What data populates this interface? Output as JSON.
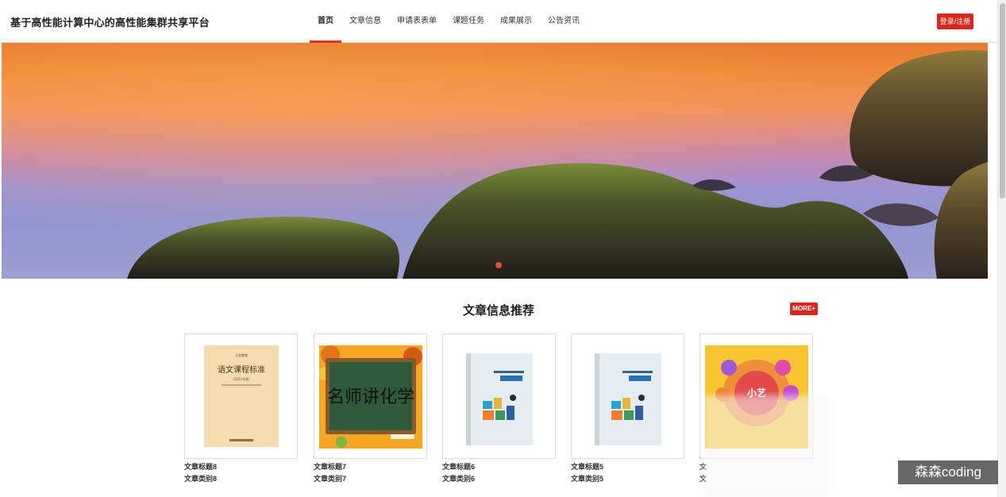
{
  "header": {
    "site_title": "基于高性能计算中心的高性能集群共享平台",
    "nav": [
      {
        "label": "首页",
        "active": true
      },
      {
        "label": "文章信息"
      },
      {
        "label": "申请表表单"
      },
      {
        "label": "课题任务"
      },
      {
        "label": "成果展示"
      },
      {
        "label": "公告资讯"
      }
    ],
    "login_label": "登录/注册"
  },
  "banner": {
    "slide_count": 1,
    "active_slide": 1
  },
  "section": {
    "title": "文章信息推荐",
    "more_label": "MORE+"
  },
  "articles": [
    {
      "title": "文章标题8",
      "category": "文章类别8",
      "cover": "yuwen-kecheng-biaozhun-book"
    },
    {
      "title": "文章标题7",
      "category": "文章类别7",
      "cover": "mingshi-jiang-huaxue-blackboard"
    },
    {
      "title": "文章标题6",
      "category": "文章类别6",
      "cover": "yuwen-kecheng-puzzle-book"
    },
    {
      "title": "文章标题5",
      "category": "文章类别5",
      "cover": "yuwen-kecheng-puzzle-book"
    },
    {
      "title": "文",
      "category": "文",
      "cover": "xiaoyi-banner-book"
    }
  ],
  "covers_text": {
    "book8_top": "义务教育",
    "book8_main": "语文课程标准",
    "book8_year": "（2022年版）",
    "book7_text": "名师讲化学",
    "book4_text": "小艺"
  },
  "watermark": "森森coding",
  "colors": {
    "accent": "#d8271f",
    "nav_underline": "#d8362a"
  }
}
